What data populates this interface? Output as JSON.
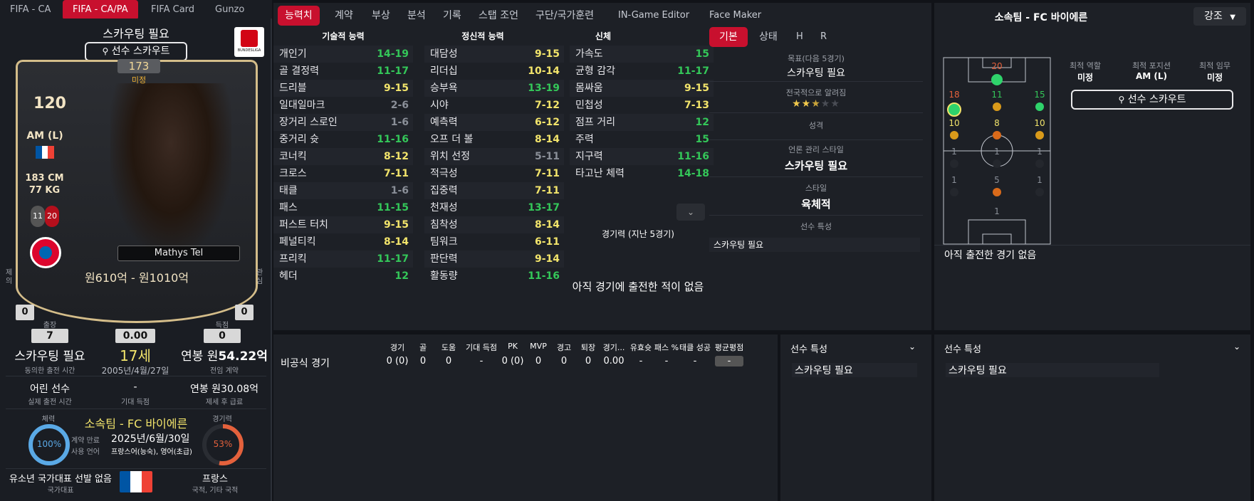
{
  "top_tabs": [
    "FIFA - CA",
    "FIFA - CA/PA",
    "FIFA Card",
    "Gunzo"
  ],
  "nav_tabs": [
    "능력치",
    "계약",
    "부상",
    "분석",
    "기록",
    "스탭 조언",
    "구단/국가훈련",
    "IN-Game Editor",
    "Face Maker"
  ],
  "card": {
    "header": "스카우팅 필요",
    "scout_button": "선수 스카우트",
    "league_logo": "BUNDESLIGA",
    "rating": "173",
    "rating_sub": "미정",
    "overall": "120",
    "position": "AM (L)",
    "height": "183 CM",
    "weight": "77 KG",
    "badge1": "11",
    "badge2": "20",
    "name": "Mathys Tel",
    "value": "원610억 - 원1010억",
    "left_side_label": "제의",
    "right_side_label": "관심",
    "left_side_value": "0",
    "right_side_value": "0"
  },
  "stats_row1": {
    "apps_label": "출장",
    "apps": "7",
    "avg": "0.00",
    "goals_label": "득점",
    "goals": "0"
  },
  "info": {
    "c1_main": "스카우팅 필요",
    "c1_sub": "동의한 출전 시간",
    "c2_main": "17세",
    "c2_sub": "2005년/4월/27일",
    "c3_main_pre": "연봉 원",
    "c3_main": "54.22억",
    "c3_sub": "전임 계약",
    "d1_main": "어린 선수",
    "d1_sub": "실제 출전 시간",
    "d2_main": "-",
    "d2_sub": "기대 득점",
    "d3_main": "연봉 원30.08억",
    "d3_sub": "제세 후 급료"
  },
  "contract": {
    "left_label": "체력",
    "left_pct": "100%",
    "right_label": "경기력",
    "right_pct": "53%",
    "club": "소속팀 - FC 바이에른",
    "exp_label": "계약 만료",
    "exp_value": "2025년/6월/30일",
    "lang_label": "사용 언어",
    "lang_value": "프랑스어(능숙), 영어(초급)",
    "left_pct_value": 100,
    "right_pct_value": 53
  },
  "nation": {
    "youth": "유소년 국가대표 선발 없음",
    "youth_sub": "국가대표",
    "country": "프랑스",
    "country_sub": "국적, 기타 국적"
  },
  "attr_headers": [
    "기술적 능력",
    "정신적 능력",
    "신체"
  ],
  "technical": [
    [
      "개인기",
      "14-19",
      "g"
    ],
    [
      "골 결정력",
      "11-17",
      "g"
    ],
    [
      "드리블",
      "9-15",
      "y"
    ],
    [
      "일대일마크",
      "2-6",
      "gr"
    ],
    [
      "장거리 스로인",
      "1-6",
      "gr"
    ],
    [
      "중거리 슛",
      "11-16",
      "g"
    ],
    [
      "코너킥",
      "8-12",
      "y"
    ],
    [
      "크로스",
      "7-11",
      "y"
    ],
    [
      "태클",
      "1-6",
      "gr"
    ],
    [
      "패스",
      "11-15",
      "g"
    ],
    [
      "퍼스트 터치",
      "9-15",
      "y"
    ],
    [
      "페널티킥",
      "8-14",
      "y"
    ],
    [
      "프리킥",
      "11-17",
      "g"
    ],
    [
      "헤더",
      "12",
      "g"
    ]
  ],
  "mental": [
    [
      "대담성",
      "9-15",
      "y"
    ],
    [
      "리더십",
      "10-14",
      "y"
    ],
    [
      "승부욕",
      "13-19",
      "g"
    ],
    [
      "시야",
      "7-12",
      "y"
    ],
    [
      "예측력",
      "6-12",
      "y"
    ],
    [
      "오프 더 볼",
      "8-14",
      "y"
    ],
    [
      "위치 선정",
      "5-11",
      "gr"
    ],
    [
      "적극성",
      "7-11",
      "y"
    ],
    [
      "집중력",
      "7-11",
      "y"
    ],
    [
      "천재성",
      "13-17",
      "g"
    ],
    [
      "침착성",
      "8-14",
      "y"
    ],
    [
      "팀워크",
      "6-11",
      "y"
    ],
    [
      "판단력",
      "9-14",
      "y"
    ],
    [
      "활동량",
      "11-16",
      "g"
    ]
  ],
  "physical": [
    [
      "가속도",
      "15",
      "g"
    ],
    [
      "균형 감각",
      "11-17",
      "g"
    ],
    [
      "몸싸움",
      "9-15",
      "y"
    ],
    [
      "민첩성",
      "7-13",
      "y"
    ],
    [
      "점프 거리",
      "12",
      "g"
    ],
    [
      "주력",
      "15",
      "g"
    ],
    [
      "지구력",
      "11-16",
      "g"
    ],
    [
      "타고난 체력",
      "14-18",
      "g"
    ]
  ],
  "form_label": "경기력 (지난 5경기)",
  "no_matches": "아직 경기에 출전한 적이 없음",
  "side_tabs": [
    "기본",
    "상태",
    "H",
    "R"
  ],
  "side": {
    "goal_label": "목표(다음 5경기)",
    "goal": "스카우팅 필요",
    "known_label": "전국적으로 알려짐",
    "personality_label": "성격",
    "media_label": "언론 관리 스타일",
    "media": "스카우팅 필요",
    "style_label": "스타일",
    "style": "육체적",
    "traits_label": "선수 특성",
    "traits": "스카우팅 필요",
    "stars": 2.5
  },
  "right": {
    "title": "소속팀 - FC 바이에른",
    "emph": "강조",
    "role_label": "최적 역할",
    "role": "미정",
    "pos_label": "최적 포지션",
    "pos": "AM (L)",
    "duty_label": "최적 임무",
    "duty": "미정",
    "scout_button": "선수 스카우트",
    "no_matches": "아직 출전한 경기 없음",
    "pitch_numbers": [
      "20",
      "18",
      "11",
      "15",
      "10",
      "8",
      "10",
      "1",
      "1",
      "1",
      "1",
      "5",
      "1",
      "1"
    ]
  },
  "table": {
    "headers": [
      "경기",
      "골",
      "도움",
      "기대 득점",
      "PK",
      "MVP",
      "경고",
      "퇴장",
      "경기...",
      "유효슛",
      "패스 %",
      "태클 성공",
      "평균평점"
    ],
    "row_label": "비공식 경기",
    "row": [
      "0 (0)",
      "0",
      "0",
      "-",
      "0 (0)",
      "0",
      "0",
      "0",
      "0.00",
      "-",
      "-",
      "-",
      "-"
    ]
  },
  "traits_panel1": {
    "title": "선수 특성",
    "value": "스카우팅 필요"
  },
  "traits_panel2": {
    "title": "선수 특성",
    "value": "스카우팅 필요"
  },
  "colors": {
    "accent": "#c8102e",
    "green": "#34c759",
    "yellow": "#f2e46b",
    "gold": "#d4bd8a"
  }
}
